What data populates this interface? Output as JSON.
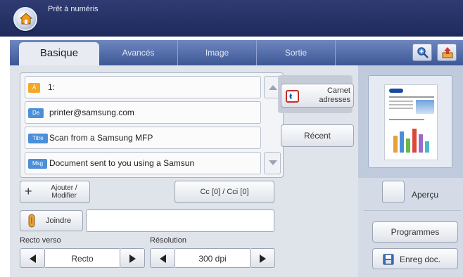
{
  "status": {
    "text": "Prêt à numéris"
  },
  "tabs": [
    {
      "label": "Basique"
    },
    {
      "label": "Avancés"
    },
    {
      "label": "Image"
    },
    {
      "label": "Sortie"
    }
  ],
  "fields": {
    "to": {
      "badge": "À",
      "value": "1:"
    },
    "from": {
      "badge": "De",
      "value": "printer@samsung.com"
    },
    "subject": {
      "badge": "Titre",
      "value": "Scan from a Samsung MFP"
    },
    "message": {
      "badge": "Msg",
      "value": "Document sent to you using a Samsun"
    }
  },
  "buttons": {
    "address_book": {
      "line1": "Carnet",
      "line2": "adresses"
    },
    "recent": "Récent",
    "add_modify": {
      "line1": "Ajouter /",
      "line2": "Modifier"
    },
    "cc_bcc": "Cc [0] / Cci [0]",
    "attach": "Joindre",
    "preview": "Aperçu",
    "programs": "Programmes",
    "save_doc": "Enreg doc."
  },
  "duplex": {
    "label": "Recto verso",
    "value": "Recto"
  },
  "resolution": {
    "label": "Résolution",
    "value": "300 dpi"
  },
  "icons": {
    "home": "home-icon",
    "zoom": "zoom-in-icon",
    "upload": "upload-icon",
    "address_book": "address-book-icon",
    "attach": "paperclip-icon",
    "save": "floppy-disk-icon"
  },
  "colors": {
    "topbar": "#1f2a5c",
    "tabs": "#4e68a6",
    "badge_to": "#f4a72a",
    "badge_other": "#4a8fd8"
  }
}
